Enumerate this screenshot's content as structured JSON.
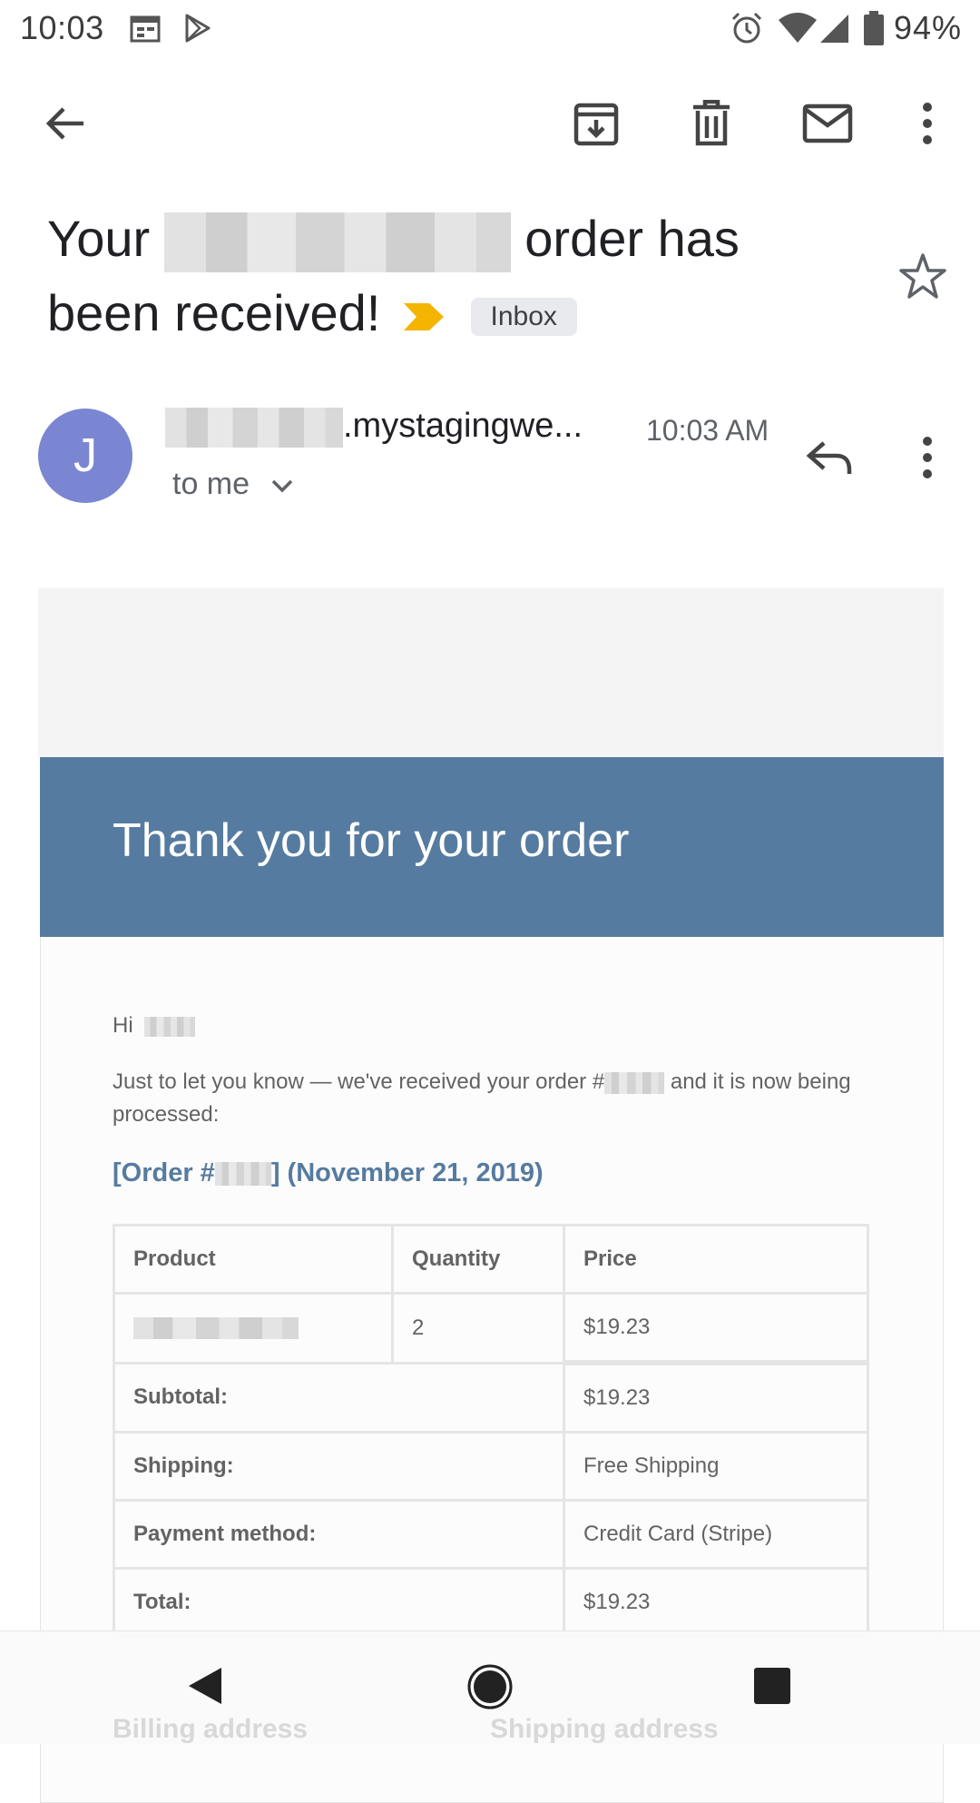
{
  "status_bar": {
    "time": "10:03",
    "battery_percent": "94%",
    "icons": [
      "calendar-icon",
      "play-store-icon",
      "alarm-icon",
      "wifi-icon",
      "cell-signal-icon",
      "battery-icon"
    ]
  },
  "toolbar": {
    "icons": [
      "back-arrow-icon",
      "archive-icon",
      "delete-icon",
      "mark-unread-icon",
      "more-vert-icon"
    ]
  },
  "subject": {
    "prefix": "Your",
    "suffix": "order has been received!",
    "label_chip": "Inbox"
  },
  "sender": {
    "avatar_initial": "J",
    "name_suffix": ".mystagingwe...",
    "time": "10:03 AM",
    "recipient": "to me"
  },
  "email": {
    "heading": "Thank you for your order",
    "greeting": "Hi",
    "notice_part1": "Just to let you know — we've received your order #",
    "notice_part2": "and it is now being processed:",
    "order_title_prefix": "[Order #",
    "order_title_suffix": "] (November 21, 2019)",
    "table": {
      "headers": [
        "Product",
        "Quantity",
        "Price"
      ],
      "item": {
        "quantity": "2",
        "price": "$19.23"
      },
      "totals": [
        {
          "label": "Subtotal:",
          "value": "$19.23"
        },
        {
          "label": "Shipping:",
          "value": "Free Shipping"
        },
        {
          "label": "Payment method:",
          "value": "Credit Card (Stripe)"
        },
        {
          "label": "Total:",
          "value": "$19.23"
        }
      ]
    },
    "billing_address": "Billing address",
    "shipping_address": "Shipping address"
  },
  "colors": {
    "header_blue": "#567ba0",
    "avatar": "#7b86d2",
    "important_marker": "#f4b400"
  }
}
